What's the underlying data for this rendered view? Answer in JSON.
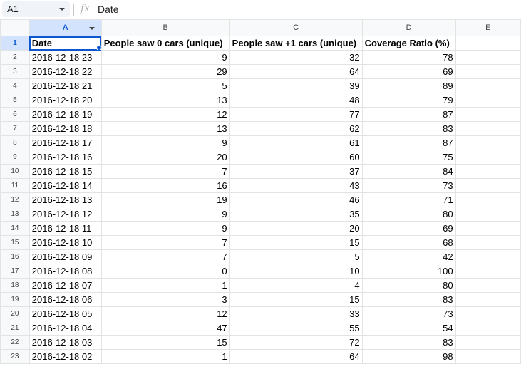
{
  "formula_bar": {
    "cell_ref": "A1",
    "fx_label": "fx",
    "value": "Date"
  },
  "columns": [
    "A",
    "B",
    "C",
    "D",
    "E"
  ],
  "header_row": {
    "row_num": "1",
    "cells": [
      "Date",
      "People saw 0 cars (unique)",
      "People saw +1 cars (unique)",
      "Coverage Ratio (%)",
      ""
    ]
  },
  "rows": [
    {
      "row_num": "2",
      "cells": [
        "2016-12-18 23",
        "9",
        "32",
        "78",
        ""
      ]
    },
    {
      "row_num": "3",
      "cells": [
        "2016-12-18 22",
        "29",
        "64",
        "69",
        ""
      ]
    },
    {
      "row_num": "4",
      "cells": [
        "2016-12-18 21",
        "5",
        "39",
        "89",
        ""
      ]
    },
    {
      "row_num": "5",
      "cells": [
        "2016-12-18 20",
        "13",
        "48",
        "79",
        ""
      ]
    },
    {
      "row_num": "6",
      "cells": [
        "2016-12-18 19",
        "12",
        "77",
        "87",
        ""
      ]
    },
    {
      "row_num": "7",
      "cells": [
        "2016-12-18 18",
        "13",
        "62",
        "83",
        ""
      ]
    },
    {
      "row_num": "8",
      "cells": [
        "2016-12-18 17",
        "9",
        "61",
        "87",
        ""
      ]
    },
    {
      "row_num": "9",
      "cells": [
        "2016-12-18 16",
        "20",
        "60",
        "75",
        ""
      ]
    },
    {
      "row_num": "10",
      "cells": [
        "2016-12-18 15",
        "7",
        "37",
        "84",
        ""
      ]
    },
    {
      "row_num": "11",
      "cells": [
        "2016-12-18 14",
        "16",
        "43",
        "73",
        ""
      ]
    },
    {
      "row_num": "12",
      "cells": [
        "2016-12-18 13",
        "19",
        "46",
        "71",
        ""
      ]
    },
    {
      "row_num": "13",
      "cells": [
        "2016-12-18 12",
        "9",
        "35",
        "80",
        ""
      ]
    },
    {
      "row_num": "14",
      "cells": [
        "2016-12-18 11",
        "9",
        "20",
        "69",
        ""
      ]
    },
    {
      "row_num": "15",
      "cells": [
        "2016-12-18 10",
        "7",
        "15",
        "68",
        ""
      ]
    },
    {
      "row_num": "16",
      "cells": [
        "2016-12-18 09",
        "7",
        "5",
        "42",
        ""
      ]
    },
    {
      "row_num": "17",
      "cells": [
        "2016-12-18 08",
        "0",
        "10",
        "100",
        ""
      ]
    },
    {
      "row_num": "18",
      "cells": [
        "2016-12-18 07",
        "1",
        "4",
        "80",
        ""
      ]
    },
    {
      "row_num": "19",
      "cells": [
        "2016-12-18 06",
        "3",
        "15",
        "83",
        ""
      ]
    },
    {
      "row_num": "20",
      "cells": [
        "2016-12-18 05",
        "12",
        "33",
        "73",
        ""
      ]
    },
    {
      "row_num": "21",
      "cells": [
        "2016-12-18 04",
        "47",
        "55",
        "54",
        ""
      ]
    },
    {
      "row_num": "22",
      "cells": [
        "2016-12-18 03",
        "15",
        "72",
        "83",
        ""
      ]
    },
    {
      "row_num": "23",
      "cells": [
        "2016-12-18 02",
        "1",
        "64",
        "98",
        ""
      ]
    }
  ]
}
